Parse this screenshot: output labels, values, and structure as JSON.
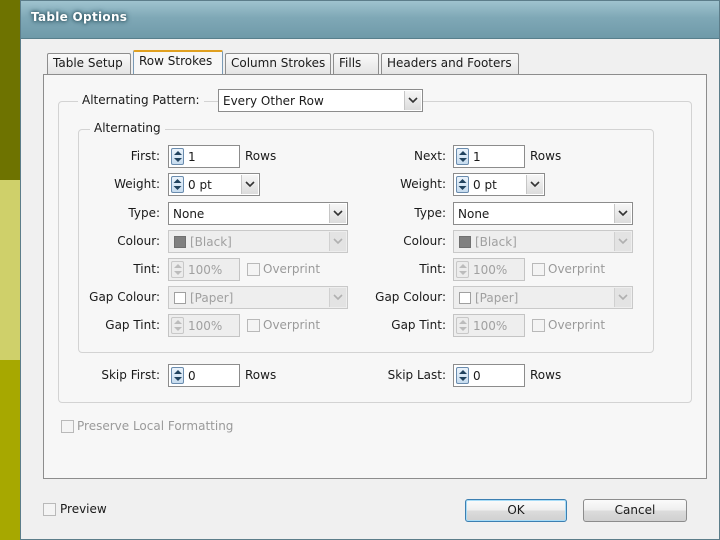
{
  "window": {
    "title": "Table Options"
  },
  "tabs": [
    {
      "label": "Table Setup",
      "active": false
    },
    {
      "label": "Row Strokes",
      "active": true
    },
    {
      "label": "Column Strokes",
      "active": false
    },
    {
      "label": "Fills",
      "active": false
    },
    {
      "label": "Headers and Footers",
      "active": false
    }
  ],
  "alternating_pattern": {
    "label": "Alternating Pattern:",
    "value": "Every Other Row"
  },
  "alternating_group": {
    "title": "Alternating",
    "first": {
      "count_label": "First:",
      "count_value": "1",
      "count_unit": "Rows",
      "weight_label": "Weight:",
      "weight_value": "0 pt",
      "type_label": "Type:",
      "type_value": "None",
      "colour_label": "Colour:",
      "colour_value": "[Black]",
      "tint_label": "Tint:",
      "tint_value": "100%",
      "overprint_label": "Overprint",
      "gap_colour_label": "Gap Colour:",
      "gap_colour_value": "[Paper]",
      "gap_tint_label": "Gap Tint:",
      "gap_tint_value": "100%",
      "gap_overprint_label": "Overprint"
    },
    "next": {
      "count_label": "Next:",
      "count_value": "1",
      "count_unit": "Rows",
      "weight_label": "Weight:",
      "weight_value": "0 pt",
      "type_label": "Type:",
      "type_value": "None",
      "colour_label": "Colour:",
      "colour_value": "[Black]",
      "tint_label": "Tint:",
      "tint_value": "100%",
      "overprint_label": "Overprint",
      "gap_colour_label": "Gap Colour:",
      "gap_colour_value": "[Paper]",
      "gap_tint_label": "Gap Tint:",
      "gap_tint_value": "100%",
      "gap_overprint_label": "Overprint"
    }
  },
  "skip": {
    "first_label": "Skip First:",
    "first_value": "0",
    "first_unit": "Rows",
    "last_label": "Skip Last:",
    "last_value": "0",
    "last_unit": "Rows"
  },
  "preserve_label": "Preserve Local Formatting",
  "preview_label": "Preview",
  "ok_label": "OK",
  "cancel_label": "Cancel",
  "colors": {
    "title_bar": "#7fa8b6",
    "active_tab_accent": "#e0a020",
    "desktop": "#a8a800"
  }
}
